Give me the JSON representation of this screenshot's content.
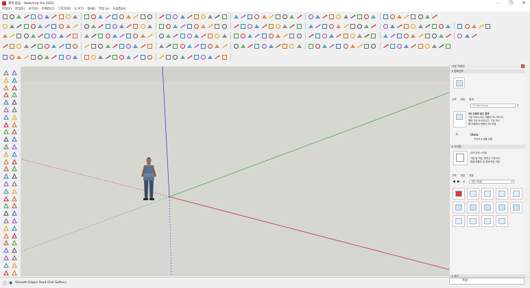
{
  "window": {
    "title": "제목 없음 - SketchUp Pro 2022",
    "controls": [
      "–",
      "❐",
      "✕"
    ]
  },
  "menu": [
    {
      "label": "파일(F)"
    },
    {
      "label": "편집(E)"
    },
    {
      "label": "보기(V)"
    },
    {
      "label": "카메라(C)"
    },
    {
      "label": "그리기(R)"
    },
    {
      "label": "도구(T)"
    },
    {
      "label": "창(W)"
    },
    {
      "label": "연장 (x)"
    },
    {
      "label": "도움말(H)"
    }
  ],
  "colors": {
    "sky": "#d2d2cd",
    "ground": "#d7d7d2",
    "axis_red": "#c0393b",
    "axis_green": "#4aa84a",
    "axis_blue": "#3b46c8",
    "accent_red": "#c8262c"
  },
  "tray": {
    "title": "기본 트레이",
    "entity_info_header": "▾ 컴포넌트",
    "components_tabs": [
      "선택",
      "편집",
      "통계"
    ],
    "search_placeholder": "3D Warehouse",
    "warehouse_title": "3D 모델의 빌드 플랫",
    "warehouse_sub": "기본 SketchUp 제품의 3D 보다 더",
    "warehouse_desc1": "원한 구성 요소입니다. 구성 요소 ",
    "warehouse_desc2": "를 이용하여 만들어 3D 모델 ",
    "chris_label": "Chris",
    "chris_sub": "구성요소 샘플 추출",
    "styles_header": "▾ 스타일",
    "styles_name": "단색 흰색 스타일",
    "styles_desc1": "기본 한 색상, 윤곽선 가장자리",
    "styles_desc2": "원을 한줄에 및 함께 복잡 색깔",
    "styles_tabs": [
      "선택",
      "편집",
      "혼합"
    ],
    "styles_dropdown": "기본 스타일",
    "collapsed_header": "▸ 태그"
  },
  "status": {
    "text": "Smooth Edges Hard (Full Soften)",
    "measurement_label": "측정"
  }
}
